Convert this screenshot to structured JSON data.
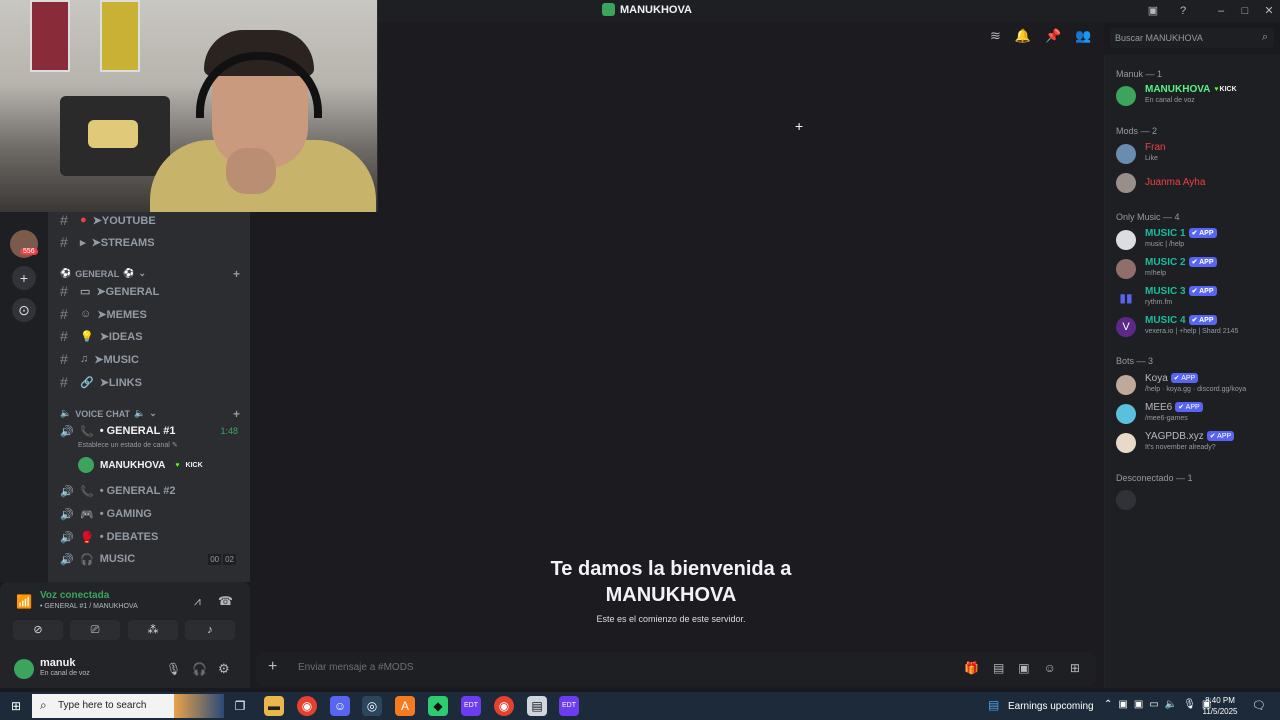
{
  "window": {
    "title": "MANUKHOVA"
  },
  "header": {
    "search_placeholder": "Buscar MANUKHOVA"
  },
  "sidebar": {
    "channels_top": [
      "➤YOUTUBE",
      "➤STREAMS"
    ],
    "category_general": "GENERAL",
    "text_channels": [
      "➤GENERAL",
      "➤MEMES",
      "➤IDEAS",
      "➤MUSIC",
      "➤LINKS"
    ],
    "category_voice": "VOICE CHAT",
    "voice_active": {
      "name": "• GENERAL #1",
      "timer": "1:48",
      "status_prompt": "Establece un estado de canal",
      "user": "MANUKHOVA",
      "user_badge": "KICK"
    },
    "voice_channels": [
      "• GENERAL #2",
      "• GAMING",
      "• DEBATES",
      "MUSIC"
    ],
    "music_counts": [
      "00",
      "02"
    ],
    "server_badge": "556"
  },
  "voice_panel": {
    "status": "Voz conectada",
    "channel": "• GENERAL #1 / MANUKHOVA"
  },
  "user_panel": {
    "name": "manuk",
    "status": "En canal de voz"
  },
  "main": {
    "welcome_line1": "Te damos la bienvenida a",
    "welcome_line2": "MANUKHOVA",
    "welcome_sub": "Este es el comienzo de este servidor.",
    "composer_placeholder": "Enviar mensaje a #MODS"
  },
  "members": {
    "groups": [
      {
        "label": "Manuk — 1",
        "items": [
          {
            "name": "MANUKHOVA",
            "badge": "KICK",
            "status": "En canal de voz",
            "color": "#57f287"
          }
        ]
      },
      {
        "label": "Mods — 2",
        "items": [
          {
            "name": "Fran",
            "status": "Like",
            "color": "#ed4245"
          },
          {
            "name": "Juanma Ayha",
            "status": "",
            "color": "#ed4245"
          }
        ]
      },
      {
        "label": "Only Music — 4",
        "items": [
          {
            "name": "MUSIC 1",
            "badge": "APP",
            "status": "music | /help",
            "color": "#1abc9c"
          },
          {
            "name": "MUSIC 2",
            "badge": "APP",
            "status": "m!help",
            "color": "#1abc9c"
          },
          {
            "name": "MUSIC 3",
            "badge": "APP",
            "status": "rythm.fm",
            "color": "#1abc9c"
          },
          {
            "name": "MUSIC 4",
            "badge": "APP",
            "status": "vexera.io | +help | Shard 2145",
            "color": "#1abc9c"
          }
        ]
      },
      {
        "label": "Bots — 3",
        "items": [
          {
            "name": "Koya",
            "badge": "APP",
            "status": "/help · koya.gg · discord.gg/koya",
            "color": "#b5bac1"
          },
          {
            "name": "MEE6",
            "badge": "APP",
            "status": "/mee6-games",
            "color": "#b5bac1"
          },
          {
            "name": "YAGPDB.xyz",
            "badge": "APP",
            "status": "It's november already?",
            "color": "#b5bac1"
          }
        ]
      },
      {
        "label": "Desconectado — 1",
        "items": [
          {
            "name": "",
            "status": "",
            "color": "#4e5058"
          }
        ]
      }
    ]
  },
  "taskbar": {
    "search_placeholder": "Type here to search",
    "weather": "Earnings upcoming",
    "time": "8:40 PM",
    "date": "11/5/2025"
  }
}
